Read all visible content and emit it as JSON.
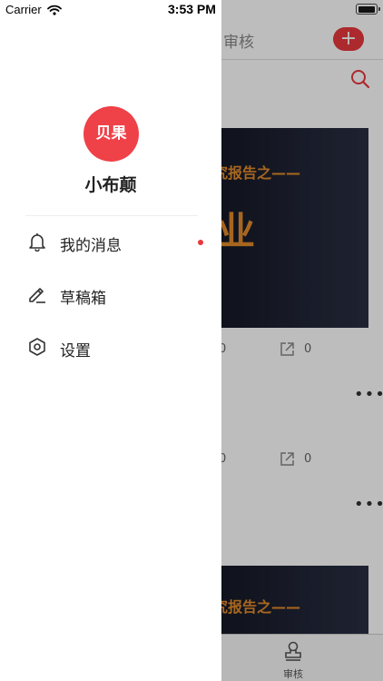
{
  "status_bar": {
    "carrier": "Carrier",
    "time": "3:53 PM"
  },
  "background": {
    "header_tab": "审核",
    "add_button": "+",
    "cards": [
      {
        "title": "究报告之——",
        "big": "业"
      },
      {
        "title": "究报告之——"
      }
    ],
    "stats": [
      "0",
      "0",
      "0",
      "0"
    ],
    "tabbar": {
      "audit_label": "审核"
    }
  },
  "drawer": {
    "avatar_text": "贝果",
    "username": "小布颠",
    "menu": [
      {
        "icon": "bell-icon",
        "label": "我的消息",
        "unread": true
      },
      {
        "icon": "pen-icon",
        "label": "草稿箱"
      },
      {
        "icon": "settings-icon",
        "label": "设置"
      }
    ]
  },
  "colors": {
    "accent": "#ef4148",
    "card_text": "#e28a2a",
    "card_bg": "#1a1f2e"
  }
}
